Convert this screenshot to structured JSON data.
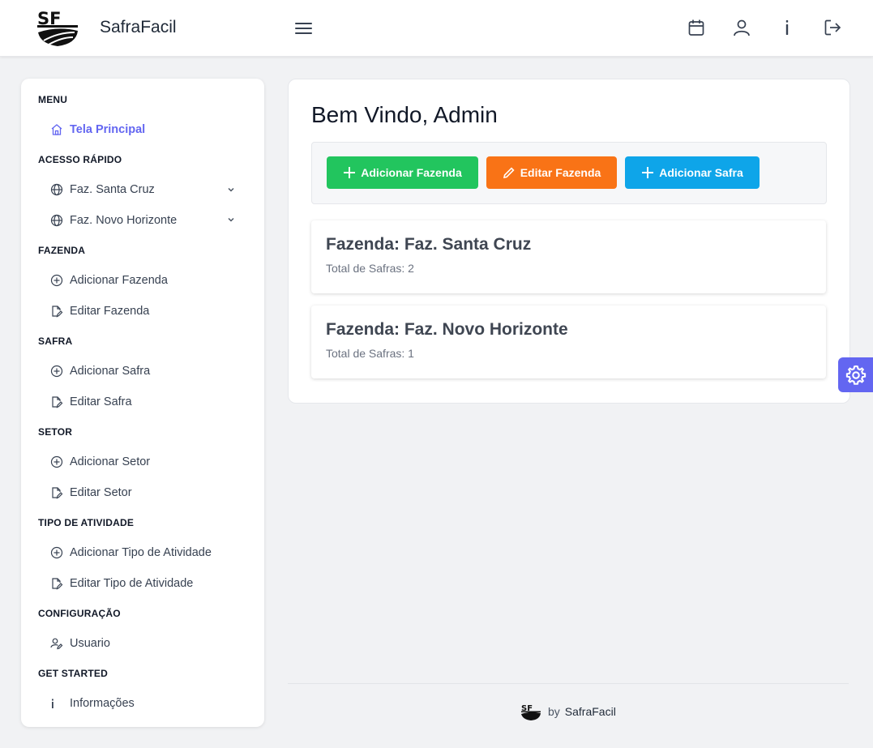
{
  "header": {
    "brand": "SafraFacil",
    "icons": [
      "calendar-icon",
      "user-icon",
      "info-icon",
      "logout-icon"
    ]
  },
  "sidebar": {
    "sections": [
      {
        "title": "MENU",
        "items": [
          {
            "label": "Tela Principal",
            "icon": "home-icon",
            "active": true
          }
        ]
      },
      {
        "title": "ACESSO RÁPIDO",
        "items": [
          {
            "label": "Faz. Santa Cruz",
            "icon": "globe-icon",
            "expandable": true
          },
          {
            "label": "Faz. Novo Horizonte",
            "icon": "globe-icon",
            "expandable": true
          }
        ]
      },
      {
        "title": "FAZENDA",
        "items": [
          {
            "label": "Adicionar Fazenda",
            "icon": "plus-circle-icon"
          },
          {
            "label": "Editar Fazenda",
            "icon": "edit-file-icon"
          }
        ]
      },
      {
        "title": "SAFRA",
        "items": [
          {
            "label": "Adicionar Safra",
            "icon": "plus-circle-icon"
          },
          {
            "label": "Editar Safra",
            "icon": "edit-file-icon"
          }
        ]
      },
      {
        "title": "SETOR",
        "items": [
          {
            "label": "Adicionar Setor",
            "icon": "plus-circle-icon"
          },
          {
            "label": "Editar Setor",
            "icon": "edit-file-icon"
          }
        ]
      },
      {
        "title": "TIPO DE ATIVIDADE",
        "items": [
          {
            "label": "Adicionar Tipo de Atividade",
            "icon": "plus-circle-icon"
          },
          {
            "label": "Editar Tipo de Atividade",
            "icon": "edit-file-icon"
          }
        ]
      },
      {
        "title": "CONFIGURAÇÃO",
        "items": [
          {
            "label": "Usuario",
            "icon": "user-edit-icon"
          }
        ]
      },
      {
        "title": "GET STARTED",
        "items": [
          {
            "label": "Informações",
            "icon": "info-icon"
          }
        ]
      }
    ]
  },
  "main": {
    "welcome": "Bem Vindo, Admin",
    "buttons": [
      {
        "label": "Adicionar Fazenda",
        "icon": "plus-icon",
        "color": "#22c55e"
      },
      {
        "label": "Editar Fazenda",
        "icon": "pencil-icon",
        "color": "#f97316"
      },
      {
        "label": "Adicionar Safra",
        "icon": "plus-icon",
        "color": "#0ea5e9"
      }
    ],
    "farms": [
      {
        "title": "Fazenda: Faz. Santa Cruz",
        "subtitle": "Total de Safras: 2"
      },
      {
        "title": "Fazenda: Faz. Novo Horizonte",
        "subtitle": "Total de Safras: 1"
      }
    ]
  },
  "footer": {
    "by": "by",
    "name": "SafraFacil"
  },
  "colors": {
    "accent": "#6366f1",
    "settings_bg": "#6366f1"
  }
}
